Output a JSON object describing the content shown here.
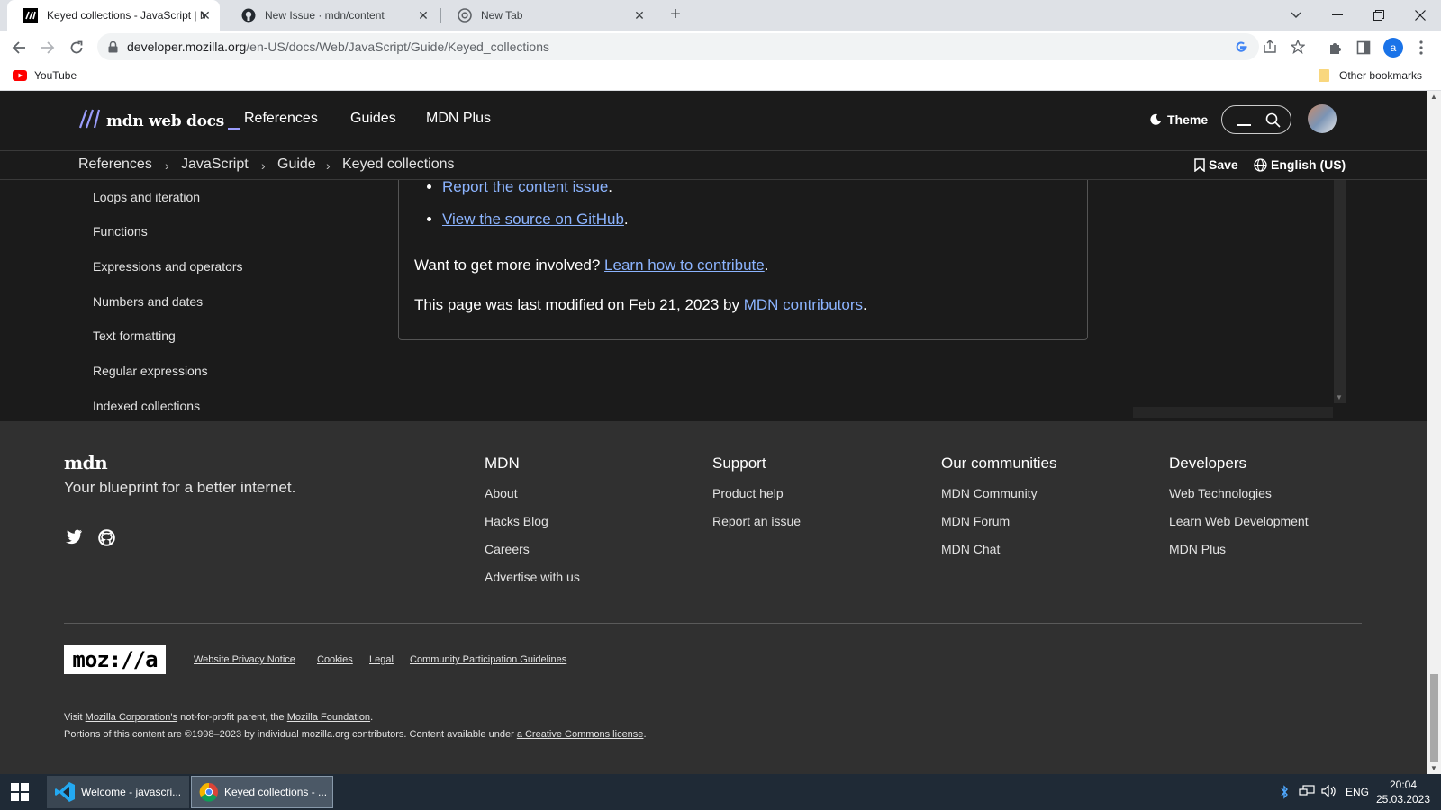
{
  "browser": {
    "tabs": [
      {
        "title": "Keyed collections - JavaScript | M",
        "icon": "mdn-favicon",
        "active": true
      },
      {
        "title": "New Issue · mdn/content",
        "icon": "github-favicon",
        "active": false
      },
      {
        "title": "New Tab",
        "icon": "chrome-favicon",
        "active": false
      }
    ],
    "url_host": "developer.mozilla.org",
    "url_path": "/en-US/docs/Web/JavaScript/Guide/Keyed_collections",
    "bookmarks": {
      "youtube": "YouTube",
      "other": "Other bookmarks"
    },
    "profile_initial": "a"
  },
  "mdn": {
    "logo_text": "mdn web docs",
    "nav": [
      "References",
      "Guides",
      "MDN Plus"
    ],
    "theme_label": "Theme",
    "breadcrumbs": [
      "References",
      "JavaScript",
      "Guide",
      "Keyed collections"
    ],
    "save_label": "Save",
    "language_label": "English (US)"
  },
  "sidebar": {
    "items": [
      "Loops and iteration",
      "Functions",
      "Expressions and operators",
      "Numbers and dates",
      "Text formatting",
      "Regular expressions",
      "Indexed collections"
    ]
  },
  "content": {
    "report_link": "Report the content issue",
    "source_link": "View the source on GitHub",
    "involved_text": "Want to get more involved?",
    "contribute_link": "Learn how to contribute",
    "modified_text": "This page was last modified on Feb 21, 2023 by",
    "contributors_link": "MDN contributors"
  },
  "footer": {
    "logo": "mdn",
    "tagline": "Your blueprint for a better internet.",
    "columns": [
      {
        "heading": "MDN",
        "links": [
          "About",
          "Hacks Blog",
          "Careers",
          "Advertise with us"
        ]
      },
      {
        "heading": "Support",
        "links": [
          "Product help",
          "Report an issue"
        ]
      },
      {
        "heading": "Our communities",
        "links": [
          "MDN Community",
          "MDN Forum",
          "MDN Chat"
        ]
      },
      {
        "heading": "Developers",
        "links": [
          "Web Technologies",
          "Learn Web Development",
          "MDN Plus"
        ]
      }
    ],
    "mozilla_logo": "moz://a",
    "legal_links": [
      "Website Privacy Notice",
      "Cookies",
      "Legal",
      "Community Participation Guidelines"
    ],
    "fine1_prefix": "Visit",
    "fine1_corp": "Mozilla Corporation's",
    "fine1_mid": "not-for-profit parent, the",
    "fine1_found": "Mozilla Foundation",
    "fine2_text": "Portions of this content are ©1998–2023 by individual mozilla.org contributors. Content available under",
    "fine2_link": "a Creative Commons license"
  },
  "taskbar": {
    "tasks": [
      {
        "title": "Welcome - javascri...",
        "icon": "vscode-icon"
      },
      {
        "title": "Keyed collections - ...",
        "icon": "chrome-icon"
      }
    ],
    "lang": "ENG",
    "time": "20:04",
    "date": "25.03.2023"
  },
  "colors": {
    "mdn_bg": "#1b1b1b",
    "footer_bg": "#303030",
    "link": "#8cb4ff",
    "accent": "#9b9dfc"
  }
}
